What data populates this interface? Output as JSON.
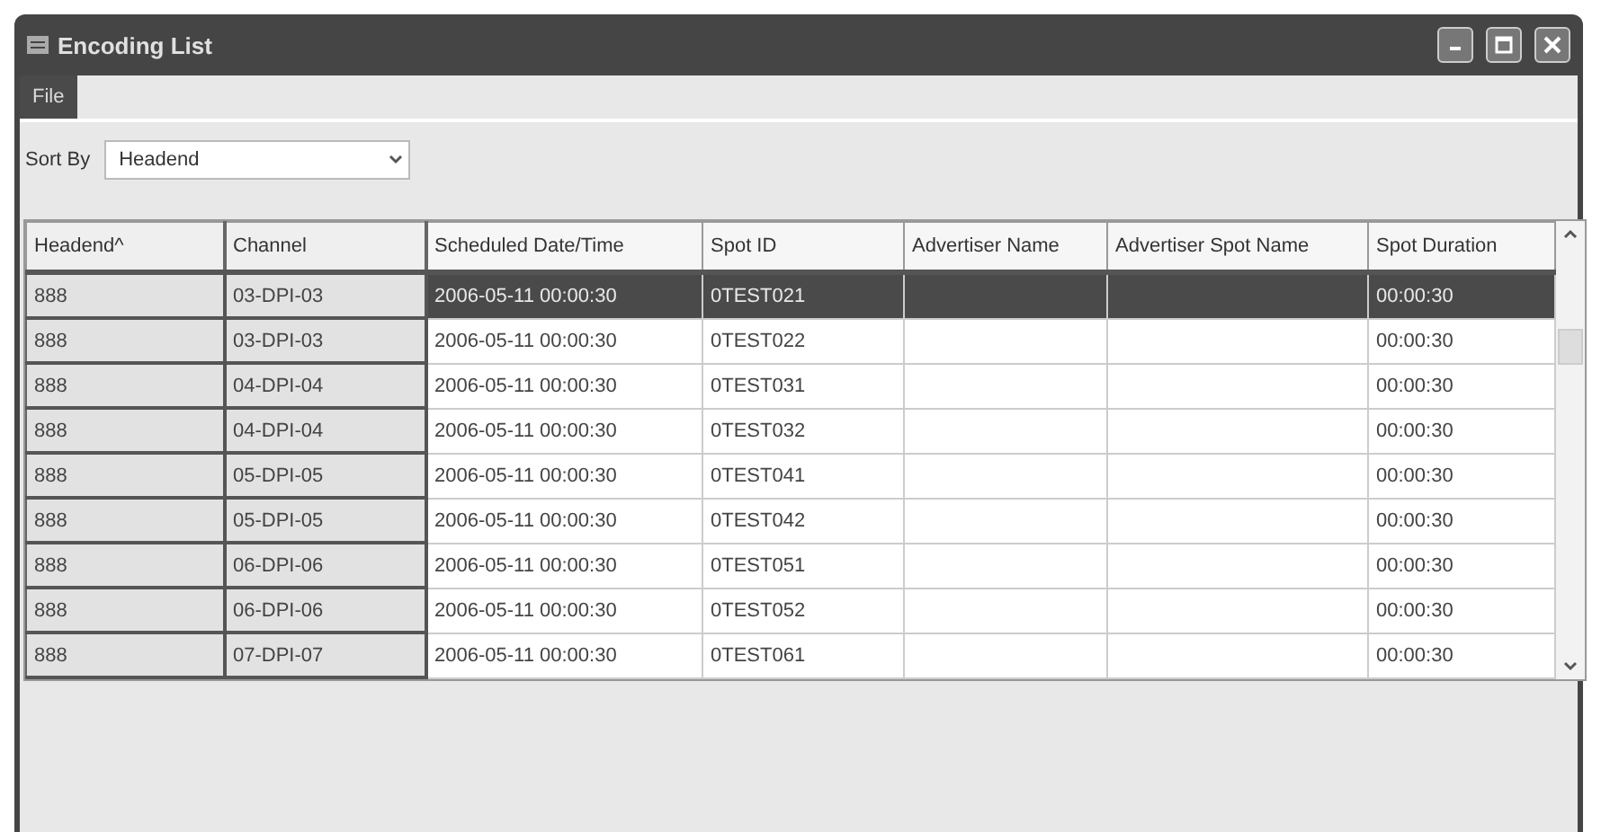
{
  "window": {
    "title": "Encoding List"
  },
  "menu": [
    {
      "label": "File",
      "highlighted": true
    }
  ],
  "sort": {
    "label": "Sort By",
    "value": "Headend"
  },
  "table": {
    "columns": [
      {
        "label": "Headend^",
        "frozen": true
      },
      {
        "label": "Channel",
        "frozen": true
      },
      {
        "label": "Scheduled Date/Time",
        "frozen": false
      },
      {
        "label": "Spot ID",
        "frozen": false
      },
      {
        "label": "Advertiser Name",
        "frozen": false
      },
      {
        "label": "Advertiser Spot Name",
        "frozen": false
      },
      {
        "label": "Spot Duration",
        "frozen": false
      }
    ],
    "rows": [
      {
        "selected": true,
        "cells": [
          "888",
          "03-DPI-03",
          "2006-05-11 00:00:30",
          "0TEST021",
          "",
          "",
          "00:00:30"
        ]
      },
      {
        "selected": false,
        "cells": [
          "888",
          "03-DPI-03",
          "2006-05-11 00:00:30",
          "0TEST022",
          "",
          "",
          "00:00:30"
        ]
      },
      {
        "selected": false,
        "cells": [
          "888",
          "04-DPI-04",
          "2006-05-11 00:00:30",
          "0TEST031",
          "",
          "",
          "00:00:30"
        ]
      },
      {
        "selected": false,
        "cells": [
          "888",
          "04-DPI-04",
          "2006-05-11 00:00:30",
          "0TEST032",
          "",
          "",
          "00:00:30"
        ]
      },
      {
        "selected": false,
        "cells": [
          "888",
          "05-DPI-05",
          "2006-05-11 00:00:30",
          "0TEST041",
          "",
          "",
          "00:00:30"
        ]
      },
      {
        "selected": false,
        "cells": [
          "888",
          "05-DPI-05",
          "2006-05-11 00:00:30",
          "0TEST042",
          "",
          "",
          "00:00:30"
        ]
      },
      {
        "selected": false,
        "cells": [
          "888",
          "06-DPI-06",
          "2006-05-11 00:00:30",
          "0TEST051",
          "",
          "",
          "00:00:30"
        ]
      },
      {
        "selected": false,
        "cells": [
          "888",
          "06-DPI-06",
          "2006-05-11 00:00:30",
          "0TEST052",
          "",
          "",
          "00:00:30"
        ]
      },
      {
        "selected": false,
        "cells": [
          "888",
          "07-DPI-07",
          "2006-05-11 00:00:30",
          "0TEST061",
          "",
          "",
          "00:00:30"
        ]
      }
    ]
  }
}
